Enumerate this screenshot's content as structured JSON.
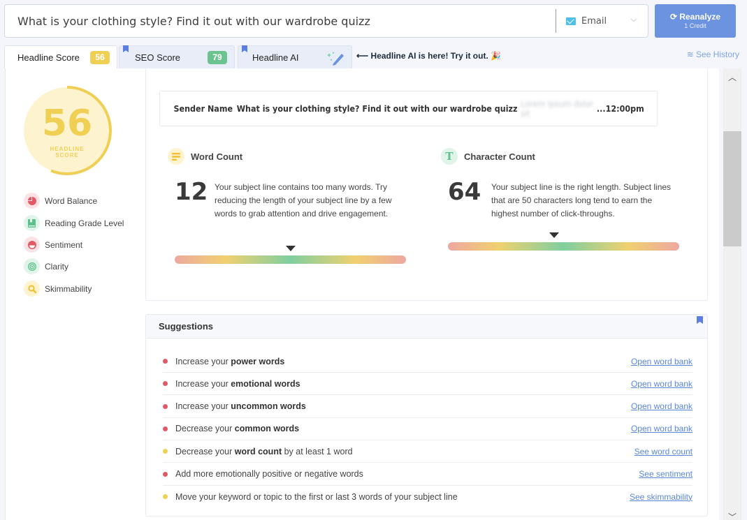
{
  "search": {
    "headline_value": "What is your clothing style? Find it out with our wardrobe quizz",
    "type_label": "Email",
    "type_icon": "envelope-icon"
  },
  "reanalyze": {
    "label": "⟳ Reanalyze",
    "sub": "1 Credit"
  },
  "tabs": [
    {
      "label": "Headline Score",
      "score": "56",
      "badge_color": "#f0cf55",
      "active": true
    },
    {
      "label": "SEO Score",
      "score": "79",
      "badge_color": "#6cc38f",
      "active": false
    },
    {
      "label": "Headline AI",
      "icon": "magic-pencil-icon",
      "active": false
    }
  ],
  "promo": "⟵ Headline AI is here! Try it out. 🎉",
  "history": "See History",
  "score": {
    "value": "56",
    "progress": 0.56,
    "caption_line1": "HEADLINE",
    "caption_line2": "SCORE",
    "color": "#f0cf55"
  },
  "metrics": [
    {
      "label": "Word Balance",
      "icon": "pie-chart-icon",
      "color": "#e05a66",
      "bg": "#fbe3e5"
    },
    {
      "label": "Reading Grade Level",
      "icon": "book-icon",
      "color": "#5cc08a",
      "bg": "#e1f4e9"
    },
    {
      "label": "Sentiment",
      "icon": "smile-icon",
      "color": "#e05a66",
      "bg": "#fbe3e5"
    },
    {
      "label": "Clarity",
      "icon": "target-icon",
      "color": "#5cc08a",
      "bg": "#e1f4e9"
    },
    {
      "label": "Skimmability",
      "icon": "search-icon",
      "color": "#f0c030",
      "bg": "#fdf3cf"
    }
  ],
  "preview": {
    "sender": "Sender Name",
    "subject": "What is your clothing style? Find it out with our wardrobe quizz",
    "preview_text": "Lorem ipsum dolor sit",
    "ellipsis": "...",
    "time": "12:00pm"
  },
  "word_count": {
    "title": "Word Count",
    "value": "12",
    "description": "Your subject line contains too many words. Try reducing the length of your subject line by a few words to grab attention and drive engagement.",
    "gauge_position": 0.5
  },
  "char_count": {
    "title": "Character Count",
    "value": "64",
    "description": "Your subject line is the right length. Subject lines that are 50 characters long tend to earn the highest number of click-throughs.",
    "gauge_position": 0.46
  },
  "suggestions": {
    "title": "Suggestions",
    "items": [
      {
        "pre": "Increase your ",
        "bold": "power words",
        "post": "",
        "link": "Open word bank",
        "status": "red"
      },
      {
        "pre": "Increase your ",
        "bold": "emotional words",
        "post": "",
        "link": "Open word bank",
        "status": "red"
      },
      {
        "pre": "Increase your ",
        "bold": "uncommon words",
        "post": "",
        "link": "Open word bank",
        "status": "red"
      },
      {
        "pre": "Decrease your ",
        "bold": "common words",
        "post": "",
        "link": "Open word bank",
        "status": "red"
      },
      {
        "pre": "Decrease your ",
        "bold": "word count",
        "post": " by at least 1 word",
        "link": "See word count",
        "status": "yellow"
      },
      {
        "pre": "Add more emotionally positive or negative words",
        "bold": "",
        "post": "",
        "link": "See sentiment",
        "status": "red"
      },
      {
        "pre": "Move your keyword or topic to the first or last 3 words of your subject line",
        "bold": "",
        "post": "",
        "link": "See skimmability",
        "status": "yellow"
      }
    ]
  },
  "colors": {
    "red": "#e05a66",
    "yellow": "#f0cf55",
    "accent": "#6b93e0",
    "link": "#5b87d9"
  }
}
